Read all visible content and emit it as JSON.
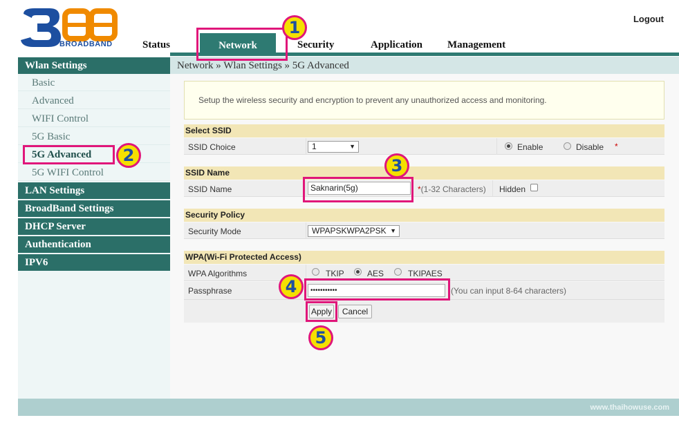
{
  "brand": {
    "logo_text": "BROADBAND",
    "logo_numeral": "3BB"
  },
  "header": {
    "logout": "Logout"
  },
  "nav": {
    "status": "Status",
    "network": "Network",
    "security": "Security",
    "application": "Application",
    "management": "Management"
  },
  "sidebar": {
    "wlan_settings": "Wlan Settings",
    "items": [
      "Basic",
      "Advanced",
      "WIFI Control",
      "5G Basic",
      "5G Advanced",
      "5G WIFI Control"
    ],
    "lan_settings": "LAN Settings",
    "broadband_settings": "BroadBand Settings",
    "dhcp_server": "DHCP Server",
    "authentication": "Authentication",
    "ipv6": "IPV6"
  },
  "breadcrumb": "Network » Wlan Settings » 5G Advanced",
  "note": "Setup the wireless security and encryption to prevent any unauthorized access and monitoring.",
  "select_ssid": {
    "heading": "Select SSID",
    "label": "SSID Choice",
    "value": "1",
    "enable": "Enable",
    "disable": "Disable",
    "required_mark": "*"
  },
  "ssid_name": {
    "heading": "SSID Name",
    "label": "SSID Name",
    "value": "Saknarin(5g)",
    "required_mark": "*",
    "hint": "(1-32 Characters)",
    "hidden": "Hidden"
  },
  "security_policy": {
    "heading": "Security Policy",
    "label": "Security Mode",
    "value": "WPAPSKWPA2PSK"
  },
  "wpa": {
    "heading": "WPA(Wi-Fi Protected Access)",
    "algo_label": "WPA Algorithms",
    "tkip": "TKIP",
    "aes": "AES",
    "tkipaes": "TKIPAES",
    "pass_label": "Passphrase",
    "pass_value": "•••••••••••",
    "pass_hint": "(You can input 8-64 characters)"
  },
  "buttons": {
    "apply": "Apply",
    "cancel": "Cancel"
  },
  "badges": [
    "1",
    "2",
    "3",
    "4",
    "5"
  ],
  "footer": {
    "watermark": "www.thaihowuse.com"
  },
  "colors": {
    "teal": "#2e7a72",
    "highlight": "#e0167a",
    "badge": "#f4e000",
    "logo_blue": "#1d4fa0",
    "logo_orange": "#f08a00"
  }
}
